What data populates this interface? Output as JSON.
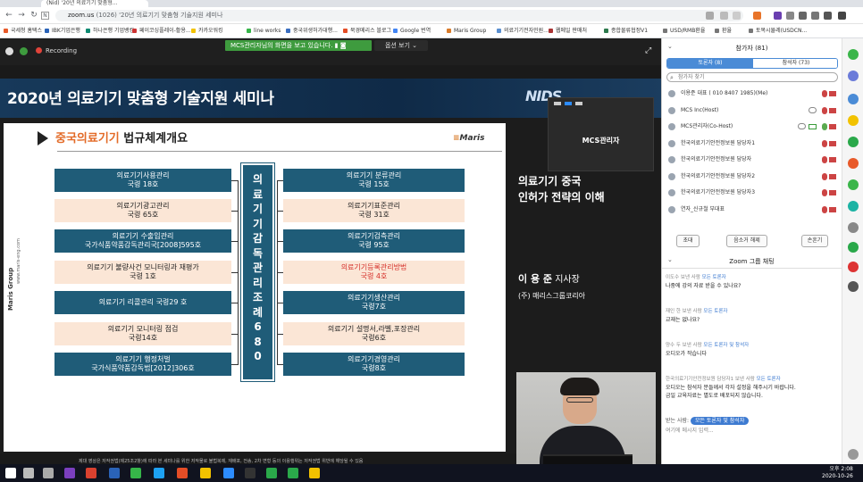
{
  "browser": {
    "tab_title": "(Nid) '20년 의료기기 맞춤형...",
    "url_host": "zoom.us",
    "url_path": " (1026) '20년 의료기기 맞춤형 기술지원 세미나",
    "bookmarks": [
      {
        "label": "국세청 홈택스",
        "color": "#e85a2a"
      },
      {
        "label": "IBK기업은행",
        "color": "#2a63b8"
      },
      {
        "label": "하나은행 기업뱅킹",
        "color": "#0d8a72"
      },
      {
        "label": "페이코싱플레이-활용...",
        "color": "#cc3333"
      },
      {
        "label": "카카오워킹",
        "color": "#f2c200"
      },
      {
        "label": "line works",
        "color": "#36b549"
      },
      {
        "label": "중국위생허가대행...",
        "color": "#3a6ec0"
      },
      {
        "label": "북경메리스 블로그",
        "color": "#e44d26"
      },
      {
        "label": "Google 번역",
        "color": "#4285f4"
      },
      {
        "label": "Maris Group",
        "color": "#d97b2a"
      },
      {
        "label": "의료기기전자민원...",
        "color": "#5a8fd0"
      },
      {
        "label": "웹메일 판매처",
        "color": "#a33"
      },
      {
        "label": "종합물류협정V1",
        "color": "#2d7a4d"
      },
      {
        "label": "USD/RMB환율",
        "color": "#777"
      },
      {
        "label": "환율",
        "color": "#777"
      },
      {
        "label": "토목시뮬레(USDCN...",
        "color": "#777"
      }
    ]
  },
  "zoom": {
    "recording": "Recording",
    "share_banner": "MCS관리자님의 화면을 보고 있습니다.",
    "view_options": "옵션 보기",
    "thumb_name": "MCS관리자"
  },
  "slide": {
    "title": "2020년 의료기기 맞춤형 기술지원 세미나",
    "nids": "NIDS",
    "subtitle_hl": "중국의료기기",
    "subtitle_rest": " 법규체계개요",
    "maris_logo": "Maris",
    "side_brand": "Maris Group",
    "side_url": "www.maris-eng.com",
    "center_col": "의료기기감독관리조례680",
    "left_boxes": [
      {
        "line1": "의료기기사용관리",
        "line2": "국령 18호",
        "style": "dark"
      },
      {
        "line1": "의료기기광고관리",
        "line2": "국령 65호",
        "style": "light"
      },
      {
        "line1": "의료기기 수출입관리",
        "line2": "국가식품약품감독관리국[2008]595호",
        "style": "dark"
      },
      {
        "line1": "의료기기 불량사건 모니터링과 재평가",
        "line2": "국령 1호",
        "style": "light"
      },
      {
        "line1": "의료기기 리콜관리 국령29 호",
        "line2": "",
        "style": "dark"
      },
      {
        "line1": "의료기기 모니터링 점검",
        "line2": "국령14호",
        "style": "light"
      },
      {
        "line1": "의료기기 행정처벌",
        "line2": "국가식품약품감독법[2012]306호",
        "style": "dark"
      }
    ],
    "right_boxes": [
      {
        "line1": "의료기기 분류관리",
        "line2": "국령 15호",
        "style": "dark"
      },
      {
        "line1": "의료기기표준관리",
        "line2": "국령 31호",
        "style": "light"
      },
      {
        "line1": "의료기기검측관리",
        "line2": "국령 95호",
        "style": "dark"
      },
      {
        "line1": "의료기기등록관리방법",
        "line2": "국령 4호",
        "style": "light",
        "red": true
      },
      {
        "line1": "의료기기생산관리",
        "line2": "국령7호",
        "style": "dark"
      },
      {
        "line1": "의료기기 설명서,라벨,포장관리",
        "line2": "국령6호",
        "style": "light"
      },
      {
        "line1": "의료기기경영관리",
        "line2": "국령8호",
        "style": "dark"
      }
    ],
    "right_title_1": "의료기기 중국",
    "right_title_2": "인허가 전략의 이해",
    "presenter_name": "이 용 준",
    "presenter_role": " 지사장",
    "presenter_company": "(주) 매리스그룹코리아",
    "copyright": "제대 영상은 저작권법(제25조2항)에 따라 본 세미나를 위한 저작물로 불법복제, 재배포, 전송, 2차 변형 등의 이용행위는 저작권법 위반에 해당될 수 있음"
  },
  "panel": {
    "title": "참가자 (81)",
    "tab_panelists": "토론자 (8)",
    "tab_attendees": "참석자 (73)",
    "search_placeholder": "참가자 찾기",
    "participants": [
      {
        "name": "이용준 대표 ( 010 8407 1985)(Me)",
        "mic": "off",
        "cam": true,
        "extra": "none"
      },
      {
        "name": "MCS Inc(Host)",
        "mic": "off",
        "cam": true,
        "extra": "cloud"
      },
      {
        "name": "MCS관리자(Co-Host)",
        "mic": "on",
        "cam": true,
        "extra": "cloud-screen"
      },
      {
        "name": "한국의료기기안전정보원 담당자1",
        "mic": "off",
        "cam": true,
        "extra": "none"
      },
      {
        "name": "한국의료기기안전정보원 담당자",
        "mic": "off",
        "cam": true,
        "extra": "none"
      },
      {
        "name": "한국의료기기안전정보원 담당자2",
        "mic": "off",
        "cam": true,
        "extra": "none"
      },
      {
        "name": "한국의료기기안전정보원 담당자3",
        "mic": "off",
        "cam": true,
        "extra": "none"
      },
      {
        "name": "연자_신규철 부대표",
        "mic": "off",
        "cam": true,
        "extra": "none"
      }
    ],
    "btn_invite": "초대",
    "btn_unmute_all": "음소거 해제",
    "btn_more": "손흔기",
    "chat_title": "Zoom 그룹 채팅",
    "chat": [
      {
        "from": "이도수 보낸 사람",
        "to": "모든 토론자",
        "text": "나중에 강의 자료 받을 수 있나요?"
      },
      {
        "from": "재인 한 보낸 사람",
        "to": "모든 토론자",
        "text": "교재는 없나요?"
      },
      {
        "from": "양수 두 보낸 사람",
        "to": "모든 토론자 및 참석자",
        "text": "오디오가 작습니다"
      },
      {
        "from": "한국의료기기안전정보원 담당자1 보낸 사람",
        "to": "모든 토론자",
        "text": "오디오는 참석자 분들께서 각자 설정을 해주시기 바랍니다.",
        "text2": "금일 교육자료는 별도로 배포되지 않습니다."
      }
    ],
    "chat_to_label": "받는 사람:",
    "chat_to_value": "모든 토론자 및 참석자",
    "chat_input_placeholder": "여기에 메시지 입력..."
  },
  "taskbar": {
    "time": "오후 2:08",
    "date": "2020-10-26"
  }
}
